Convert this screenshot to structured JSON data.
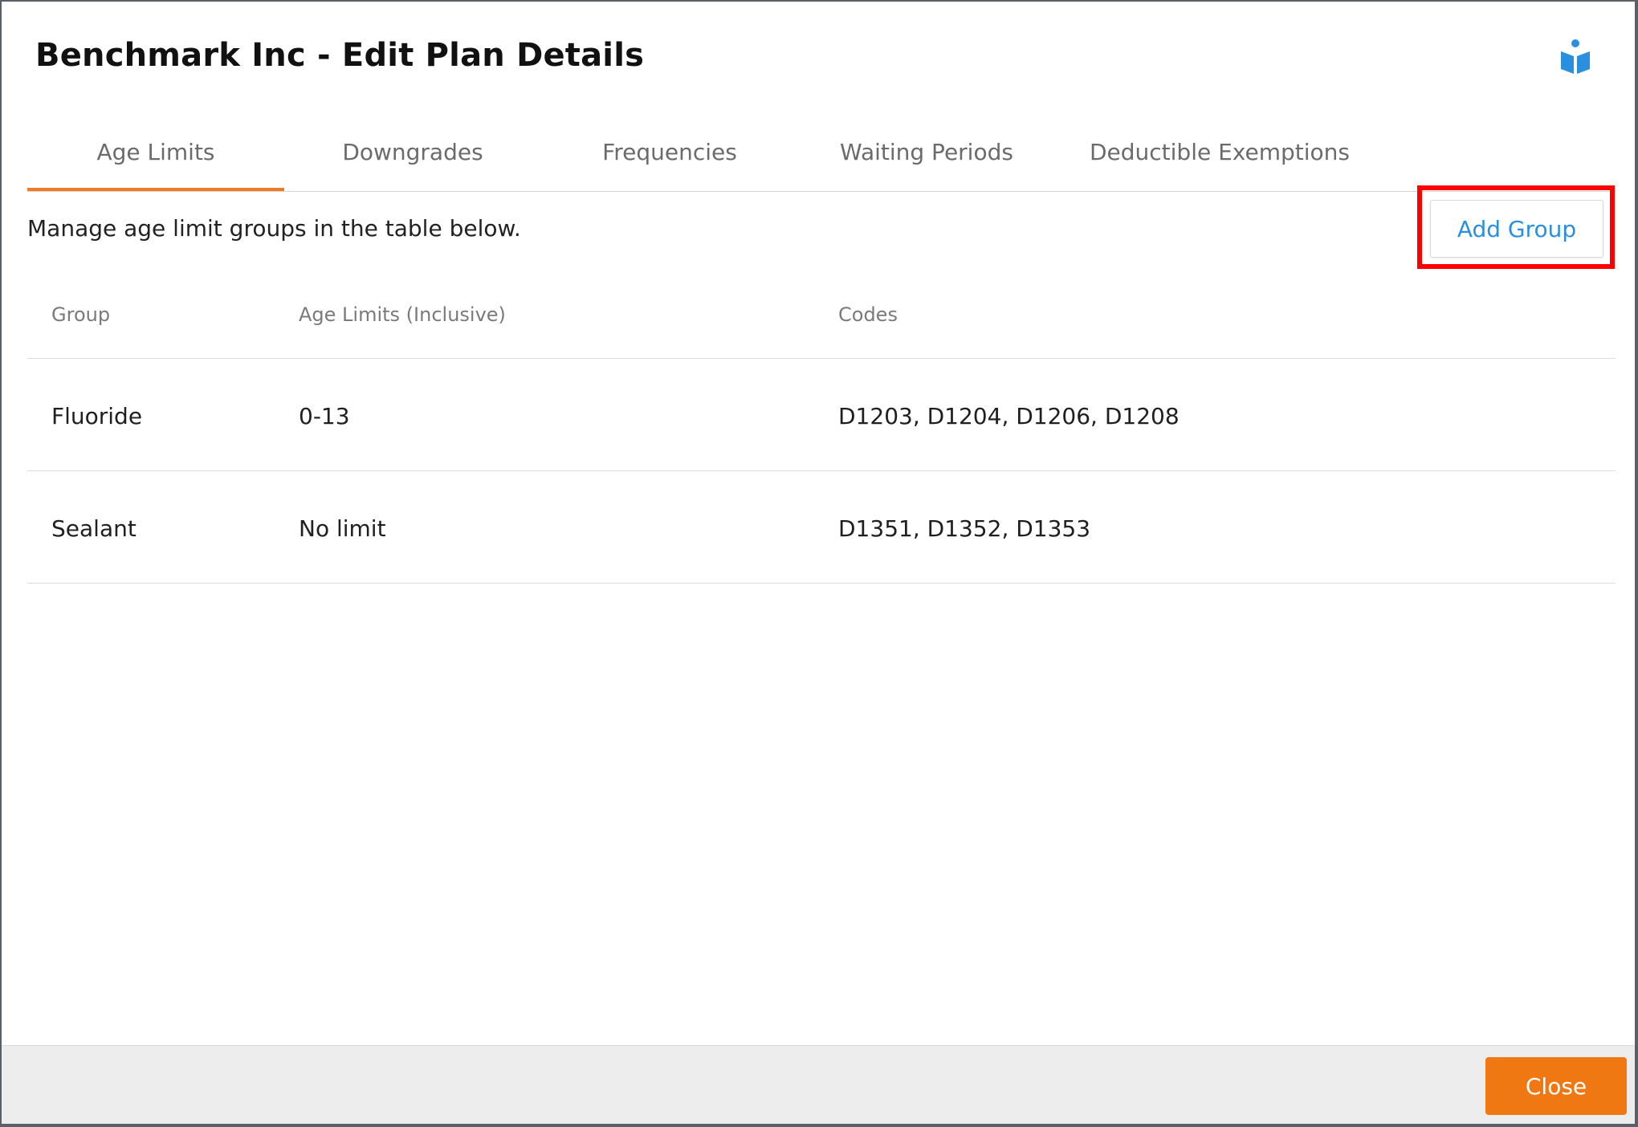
{
  "dialog": {
    "title": "Benchmark Inc - Edit Plan Details",
    "help_icon": "reader-book-icon",
    "accent_color": "#ee7a23",
    "link_color": "#2b8fe0"
  },
  "tabs": [
    {
      "label": "Age Limits",
      "active": true
    },
    {
      "label": "Downgrades",
      "active": false
    },
    {
      "label": "Frequencies",
      "active": false
    },
    {
      "label": "Waiting Periods",
      "active": false
    },
    {
      "label": "Deductible Exemptions",
      "active": false
    }
  ],
  "panel": {
    "description": "Manage age limit groups in the table below.",
    "add_button_label": "Add Group"
  },
  "table": {
    "headers": [
      "Group",
      "Age Limits (Inclusive)",
      "Codes"
    ],
    "rows": [
      {
        "group": "Fluoride",
        "age_limits": "0-13",
        "codes": "D1203, D1204, D1206, D1208"
      },
      {
        "group": "Sealant",
        "age_limits": "No limit",
        "codes": "D1351, D1352, D1353"
      }
    ]
  },
  "footer": {
    "close_label": "Close",
    "close_color": "#f07813"
  }
}
